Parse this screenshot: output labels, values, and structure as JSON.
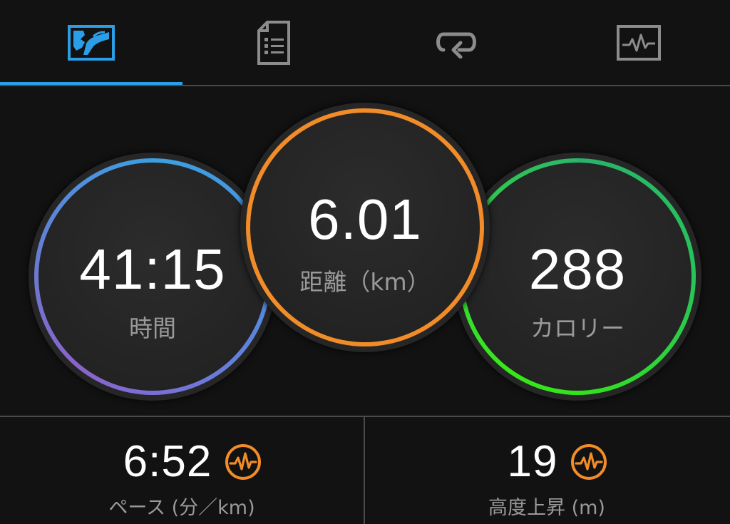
{
  "tabs": [
    {
      "name": "map-tab",
      "icon": "map-icon",
      "active": true
    },
    {
      "name": "details-tab",
      "icon": "document-list-icon",
      "active": false
    },
    {
      "name": "laps-tab",
      "icon": "loop-icon",
      "active": false
    },
    {
      "name": "charts-tab",
      "icon": "chart-pulse-icon",
      "active": false
    }
  ],
  "colors": {
    "active_tab": "#2a9ee6",
    "inactive_tab": "#8c8c8c",
    "time_ring": "#3ba0e0",
    "distance_ring": "#f28c28",
    "calories_ring": "#33e21c",
    "badge": "#f28c28"
  },
  "summary": {
    "time": {
      "value": "41:15",
      "label": "時間"
    },
    "distance": {
      "value": "6.01",
      "label": "距離（km）"
    },
    "calories": {
      "value": "288",
      "label": "カロリー"
    }
  },
  "stats": {
    "pace": {
      "value": "6:52",
      "label": "ペース (分／km)",
      "icon": "pulse-badge-icon"
    },
    "elevation": {
      "value": "19",
      "label": "高度上昇 (m)",
      "icon": "pulse-badge-icon"
    }
  }
}
